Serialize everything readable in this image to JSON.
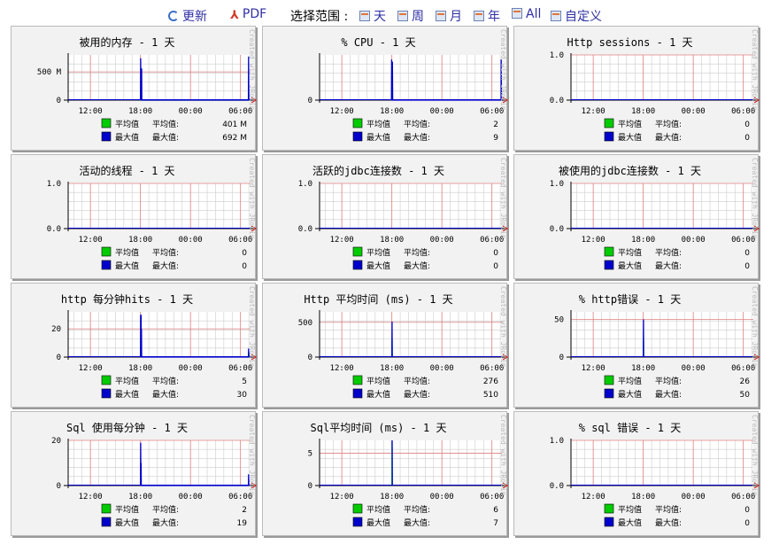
{
  "toolbar": {
    "refresh": "更新",
    "pdf": "PDF",
    "range_label": "选择范围 :",
    "day": "天",
    "week": "周",
    "month": "月",
    "year": "年",
    "all": "All",
    "custom": "自定义"
  },
  "legend_avg": "平均值",
  "legend_max": "最大值",
  "watermark": "Created with JRobin",
  "colors": {
    "avg": "#00cc00",
    "max": "#0000cc",
    "grid_major": "#e08080",
    "grid_minor": "#cccccc"
  },
  "chart_data": [
    {
      "type": "line",
      "title": "被用的内存 - 1 天",
      "x": [
        "12:00",
        "18:00",
        "00:00",
        "06:00"
      ],
      "yticks": [
        "0",
        "500 M"
      ],
      "ylim": [
        0,
        800
      ],
      "ylabel": "",
      "avg_label": "平均值:",
      "avg_value": "401 M",
      "max_label": "最大值:",
      "max_value": "692 M",
      "series": [
        {
          "name": "平均值",
          "values": [
            [
              18.0,
              0
            ],
            [
              18.02,
              180
            ],
            [
              18.1,
              180
            ],
            [
              18.12,
              0
            ],
            [
              6.95,
              0
            ],
            [
              6.97,
              180
            ],
            [
              7.0,
              0
            ]
          ]
        },
        {
          "name": "最大值",
          "values": [
            [
              18.0,
              0
            ],
            [
              18.02,
              740
            ],
            [
              18.06,
              0
            ],
            [
              18.12,
              0
            ],
            [
              18.14,
              560
            ],
            [
              18.16,
              0
            ],
            [
              6.95,
              0
            ],
            [
              6.97,
              770
            ],
            [
              7.0,
              0
            ]
          ]
        }
      ]
    },
    {
      "type": "line",
      "title": "% CPU - 1 天",
      "x": [
        "12:00",
        "18:00",
        "00:00",
        "06:00"
      ],
      "yticks": [
        "0"
      ],
      "ylim": [
        0,
        10
      ],
      "ylabel": "",
      "avg_label": "平均值:",
      "avg_value": "2",
      "max_label": "最大值:",
      "max_value": "9",
      "series": [
        {
          "name": "平均值",
          "values": []
        },
        {
          "name": "最大值",
          "values": [
            [
              17.95,
              0
            ],
            [
              17.97,
              9
            ],
            [
              18.0,
              0
            ],
            [
              18.05,
              0
            ],
            [
              18.07,
              8.5
            ],
            [
              18.1,
              0
            ],
            [
              7.1,
              0
            ],
            [
              7.12,
              9
            ],
            [
              7.15,
              0
            ]
          ]
        }
      ]
    },
    {
      "type": "line",
      "title": "Http sessions - 1 天",
      "x": [
        "12:00",
        "18:00",
        "00:00",
        "06:00"
      ],
      "yticks": [
        "0.0",
        "1.0"
      ],
      "ylim": [
        0,
        1
      ],
      "ylabel": "",
      "avg_label": "平均值:",
      "avg_value": "0",
      "max_label": "最大值:",
      "max_value": "0",
      "series": []
    },
    {
      "type": "line",
      "title": "活动的线程 - 1 天",
      "x": [
        "12:00",
        "18:00",
        "00:00",
        "06:00"
      ],
      "yticks": [
        "0.0",
        "1.0"
      ],
      "ylim": [
        0,
        1
      ],
      "ylabel": "",
      "avg_label": "平均值:",
      "avg_value": "0",
      "max_label": "最大值:",
      "max_value": "0",
      "series": []
    },
    {
      "type": "line",
      "title": "活跃的jdbc连接数 - 1 天",
      "x": [
        "12:00",
        "18:00",
        "00:00",
        "06:00"
      ],
      "yticks": [
        "0.0",
        "1.0"
      ],
      "ylim": [
        0,
        1
      ],
      "ylabel": "",
      "avg_label": "平均值:",
      "avg_value": "0",
      "max_label": "最大值:",
      "max_value": "0",
      "series": []
    },
    {
      "type": "line",
      "title": "被使用的jdbc连接数 - 1 天",
      "x": [
        "12:00",
        "18:00",
        "00:00",
        "06:00"
      ],
      "yticks": [
        "0.0",
        "1.0"
      ],
      "ylim": [
        0,
        1
      ],
      "ylabel": "",
      "avg_label": "平均值:",
      "avg_value": "0",
      "max_label": "最大值:",
      "max_value": "0",
      "series": []
    },
    {
      "type": "line",
      "title": "http 每分钟hits - 1 天",
      "x": [
        "12:00",
        "18:00",
        "00:00",
        "06:00"
      ],
      "yticks": [
        "0",
        "20"
      ],
      "ylim": [
        0,
        32
      ],
      "ylabel": "",
      "avg_label": "平均值:",
      "avg_value": "5",
      "max_label": "最大值:",
      "max_value": "30",
      "series": [
        {
          "name": "平均值",
          "values": [
            [
              7.0,
              0
            ],
            [
              7.02,
              3
            ],
            [
              7.05,
              0
            ]
          ]
        },
        {
          "name": "最大值",
          "values": [
            [
              18.0,
              0
            ],
            [
              18.02,
              30
            ],
            [
              18.06,
              0
            ],
            [
              18.08,
              30
            ],
            [
              18.1,
              0
            ],
            [
              18.12,
              20
            ],
            [
              18.14,
              0
            ],
            [
              6.95,
              0
            ],
            [
              6.97,
              6
            ],
            [
              7.0,
              0
            ]
          ]
        }
      ]
    },
    {
      "type": "line",
      "title": "Http 平均时间 (ms) - 1 天",
      "x": [
        "12:00",
        "18:00",
        "00:00",
        "06:00"
      ],
      "yticks": [
        "0",
        "500"
      ],
      "ylim": [
        0,
        650
      ],
      "ylabel": "",
      "avg_label": "平均值:",
      "avg_value": "276",
      "max_label": "最大值:",
      "max_value": "510",
      "series": [
        {
          "name": "平均值",
          "values": [
            [
              18.0,
              0
            ],
            [
              18.02,
              276
            ],
            [
              18.05,
              0
            ]
          ]
        },
        {
          "name": "最大值",
          "values": [
            [
              18.0,
              0
            ],
            [
              18.02,
              510
            ],
            [
              18.05,
              0
            ]
          ]
        }
      ]
    },
    {
      "type": "line",
      "title": "% http错误 - 1 天",
      "x": [
        "12:00",
        "18:00",
        "00:00",
        "06:00"
      ],
      "yticks": [
        "0",
        "50"
      ],
      "ylim": [
        0,
        60
      ],
      "ylabel": "",
      "avg_label": "平均值:",
      "avg_value": "26",
      "max_label": "最大值:",
      "max_value": "50",
      "series": [
        {
          "name": "平均值",
          "values": [
            [
              18.0,
              0
            ],
            [
              18.02,
              26
            ],
            [
              18.05,
              0
            ]
          ]
        },
        {
          "name": "最大值",
          "values": [
            [
              18.0,
              0
            ],
            [
              18.02,
              50
            ],
            [
              18.05,
              0
            ]
          ]
        }
      ]
    },
    {
      "type": "line",
      "title": "Sql 使用每分钟 - 1 天",
      "x": [
        "12:00",
        "18:00",
        "00:00",
        "06:00"
      ],
      "yticks": [
        "0",
        "20"
      ],
      "ylim": [
        0,
        20
      ],
      "ylabel": "",
      "avg_label": "平均值:",
      "avg_value": "2",
      "max_label": "最大值:",
      "max_value": "19",
      "series": [
        {
          "name": "平均值",
          "values": []
        },
        {
          "name": "最大值",
          "values": [
            [
              18.0,
              0
            ],
            [
              18.02,
              19
            ],
            [
              18.06,
              0
            ],
            [
              18.08,
              10
            ],
            [
              18.1,
              0
            ],
            [
              6.95,
              0
            ],
            [
              6.97,
              5
            ],
            [
              7.0,
              0
            ]
          ]
        }
      ]
    },
    {
      "type": "line",
      "title": "Sql平均时间 (ms) - 1 天",
      "x": [
        "12:00",
        "18:00",
        "00:00",
        "06:00"
      ],
      "yticks": [
        "0",
        "5"
      ],
      "ylim": [
        0,
        7
      ],
      "ylabel": "",
      "avg_label": "平均值:",
      "avg_value": "6",
      "max_label": "最大值:",
      "max_value": "7",
      "series": [
        {
          "name": "平均值",
          "values": [
            [
              18.0,
              0
            ],
            [
              18.02,
              6.5
            ],
            [
              18.05,
              0
            ]
          ]
        },
        {
          "name": "最大值",
          "values": [
            [
              18.02,
              6.5
            ],
            [
              18.04,
              7
            ],
            [
              18.06,
              0
            ]
          ]
        }
      ]
    },
    {
      "type": "line",
      "title": "% sql 错误 - 1 天",
      "x": [
        "12:00",
        "18:00",
        "00:00",
        "06:00"
      ],
      "yticks": [
        "0.0",
        "1.0"
      ],
      "ylim": [
        0,
        1
      ],
      "ylabel": "",
      "avg_label": "平均值:",
      "avg_value": "0",
      "max_label": "最大值:",
      "max_value": "0",
      "series": []
    }
  ]
}
